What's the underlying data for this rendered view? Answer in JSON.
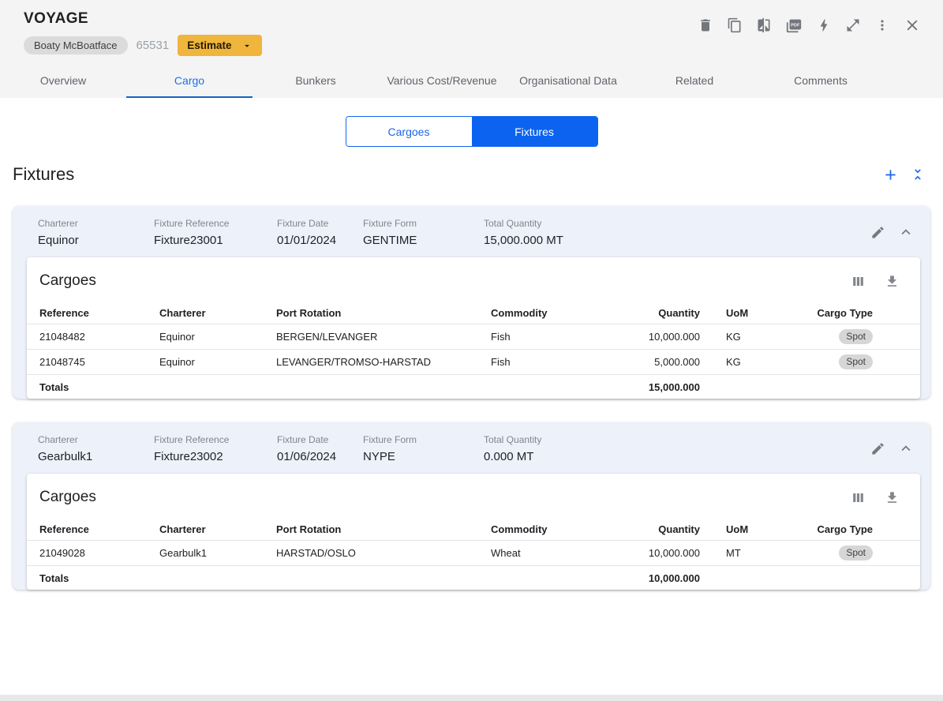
{
  "colors": {
    "accent_blue": "#0B63F0",
    "tab_active_blue": "#1A73E8",
    "estimate_amber": "#EFB53D",
    "card_header_bg": "#EDF1F9",
    "spot_chip_gray": "#D6D6D6"
  },
  "header": {
    "title": "VOYAGE",
    "vessel_chip": "Boaty McBoatface",
    "voyage_number": "65531",
    "estimate_button": "Estimate",
    "action_icons": [
      "delete-icon",
      "duplicate-icon",
      "compare-icon",
      "pdf-icon",
      "bolt-icon",
      "expand-icon",
      "more-vert-icon",
      "close-icon"
    ]
  },
  "tabs": [
    {
      "label": "Overview",
      "active": false
    },
    {
      "label": "Cargo",
      "active": true
    },
    {
      "label": "Bunkers",
      "active": false
    },
    {
      "label": "Various Cost/Revenue",
      "active": false
    },
    {
      "label": "Organisational Data",
      "active": false
    },
    {
      "label": "Related",
      "active": false
    },
    {
      "label": "Comments",
      "active": false
    }
  ],
  "view_toggle": {
    "options": [
      {
        "label": "Cargoes",
        "active": false
      },
      {
        "label": "Fixtures",
        "active": true
      }
    ]
  },
  "section": {
    "title": "Fixtures",
    "action_icons": [
      "add-icon",
      "collapse-all-icon"
    ]
  },
  "fixtures": [
    {
      "fields": [
        {
          "label": "Charterer",
          "value": "Equinor"
        },
        {
          "label": "Fixture Reference",
          "value": "Fixture23001"
        },
        {
          "label": "Fixture Date",
          "value": "01/01/2024"
        },
        {
          "label": "Fixture Form",
          "value": "GENTIME"
        },
        {
          "label": "Total Quantity",
          "value": "15,000.000 MT"
        }
      ],
      "cargoes": {
        "title": "Cargoes",
        "columns": [
          "Reference",
          "Charterer",
          "Port Rotation",
          "Commodity",
          "Quantity",
          "UoM",
          "Cargo Type"
        ],
        "rows": [
          {
            "reference": "21048482",
            "charterer": "Equinor",
            "port_rotation": "BERGEN/LEVANGER",
            "commodity": "Fish",
            "quantity": "10,000.000",
            "uom": "KG",
            "cargo_type": "Spot"
          },
          {
            "reference": "21048745",
            "charterer": "Equinor",
            "port_rotation": "LEVANGER/TROMSO-HARSTAD",
            "commodity": "Fish",
            "quantity": "5,000.000",
            "uom": "KG",
            "cargo_type": "Spot"
          }
        ],
        "totals": {
          "label": "Totals",
          "quantity": "15,000.000"
        }
      }
    },
    {
      "fields": [
        {
          "label": "Charterer",
          "value": "Gearbulk1"
        },
        {
          "label": "Fixture Reference",
          "value": "Fixture23002"
        },
        {
          "label": "Fixture Date",
          "value": "01/06/2024"
        },
        {
          "label": "Fixture Form",
          "value": "NYPE"
        },
        {
          "label": "Total Quantity",
          "value": "0.000 MT"
        }
      ],
      "cargoes": {
        "title": "Cargoes",
        "columns": [
          "Reference",
          "Charterer",
          "Port Rotation",
          "Commodity",
          "Quantity",
          "UoM",
          "Cargo Type"
        ],
        "rows": [
          {
            "reference": "21049028",
            "charterer": "Gearbulk1",
            "port_rotation": "HARSTAD/OSLO",
            "commodity": "Wheat",
            "quantity": "10,000.000",
            "uom": "MT",
            "cargo_type": "Spot"
          }
        ],
        "totals": {
          "label": "Totals",
          "quantity": "10,000.000"
        }
      }
    }
  ]
}
